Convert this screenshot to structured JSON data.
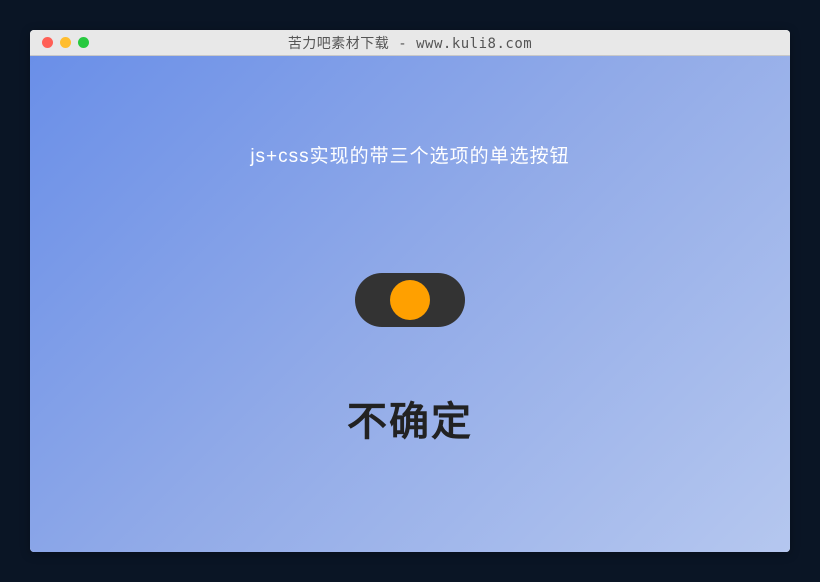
{
  "window": {
    "title": "苦力吧素材下载 - www.kuli8.com"
  },
  "content": {
    "heading": "js+css实现的带三个选项的单选按钮",
    "toggle": {
      "state": "middle",
      "knob_color": "#ffa000",
      "track_color": "#333333"
    },
    "status_label": "不确定"
  }
}
